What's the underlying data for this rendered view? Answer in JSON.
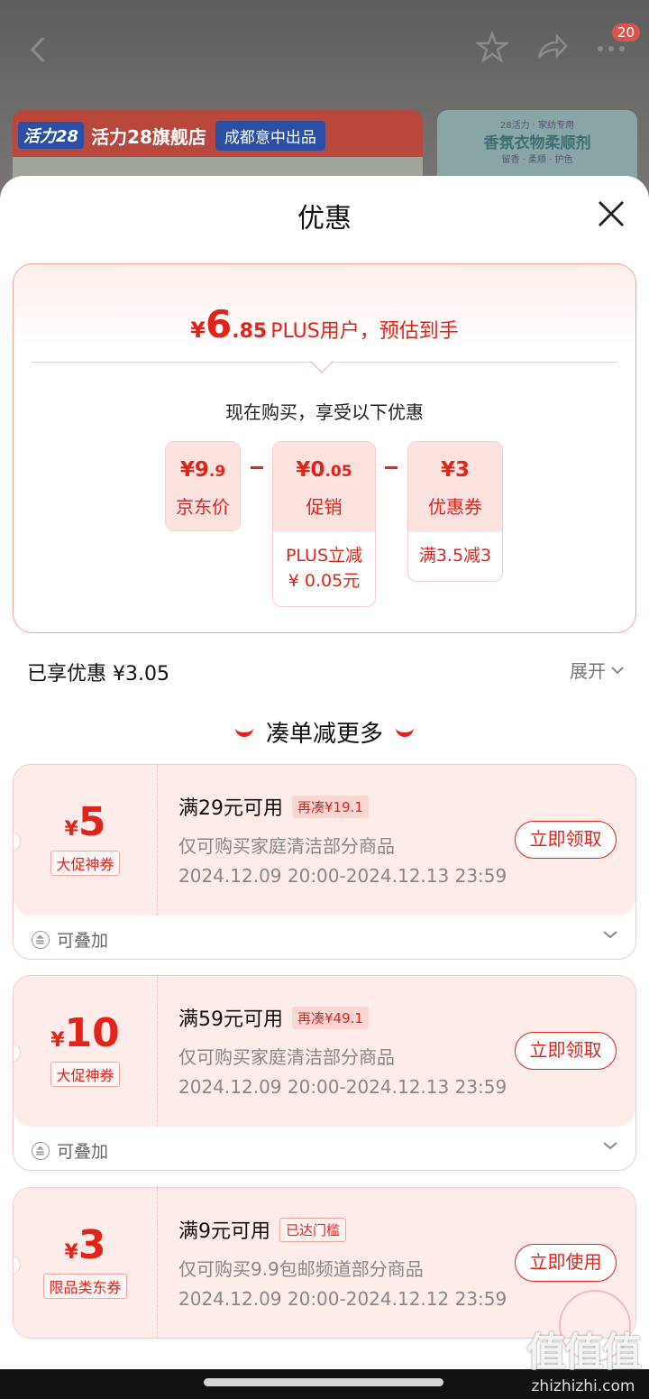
{
  "background": {
    "badge_count": "20",
    "banner_logo": "活力28",
    "store_name": "活力28旗舰店",
    "origin_tag": "成都意中出品",
    "banner2_small": "28活力 · 家纺专用",
    "banner2_title": "香氛衣物柔顺剂",
    "banner2_sub": "留香 · 柔顺 · 护色"
  },
  "sheet": {
    "title": "优惠"
  },
  "summary": {
    "yen": "¥",
    "price_int": "6",
    "price_dec": ".85",
    "price_text": "PLUS用户，预估到手",
    "enjoy_text": "现在购买，享受以下优惠",
    "cards": [
      {
        "value_main": "¥9",
        "value_small": ".9",
        "label": "京东价",
        "extra": ""
      },
      {
        "value_main": "¥0",
        "value_small": ".05",
        "label": "促销",
        "extra": "PLUS立减\n¥ 0.05元"
      },
      {
        "value_main": "¥3",
        "value_small": "",
        "label": "优惠券",
        "extra": "满3.5减3"
      }
    ]
  },
  "enjoyed": "已享优惠 ¥3.05",
  "expand_label": "展开",
  "more_title": "凑单减更多",
  "coupons": [
    {
      "yen": "¥",
      "amount": "5",
      "tag": "大促神券",
      "condition": "满29元可用",
      "badge": "再凑¥19.1",
      "scope": "仅可购买家庭清洁部分商品",
      "time": "2024.12.09 20:00-2024.12.13 23:59",
      "button": "立即领取",
      "footer": "可叠加"
    },
    {
      "yen": "¥",
      "amount": "10",
      "tag": "大促神券",
      "condition": "满59元可用",
      "badge": "再凑¥49.1",
      "scope": "仅可购买家庭清洁部分商品",
      "time": "2024.12.09 20:00-2024.12.13 23:59",
      "button": "立即领取",
      "footer": "可叠加"
    },
    {
      "yen": "¥",
      "amount": "3",
      "tag": "限品类东券",
      "condition": "满9元可用",
      "badge": "已达门槛",
      "scope": "仅可购买9.9包邮频道部分商品",
      "time": "2024.12.09 20:00-2024.12.12 23:59",
      "button": "立即使用",
      "footer": ""
    }
  ],
  "watermark": {
    "big": "值值值",
    "small": "zhizhizhi.com"
  },
  "colors": {
    "accent": "#e2231a",
    "card_bg": "#fdecea"
  }
}
